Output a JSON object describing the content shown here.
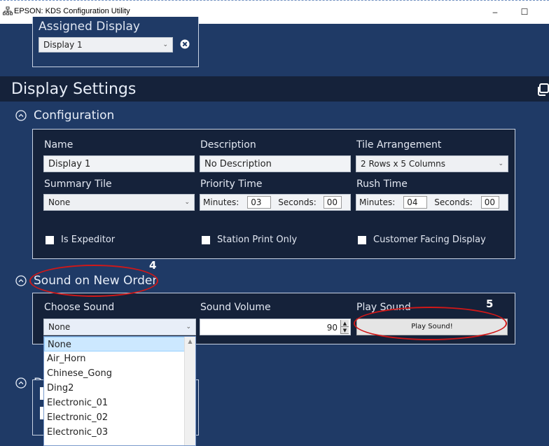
{
  "window": {
    "title": "EPSON: KDS Configuration Utility",
    "min_glyph": "–",
    "max_glyph": "☐"
  },
  "assigned_display": {
    "label": "Assigned Display",
    "value": "Display 1"
  },
  "display_settings": {
    "title": "Display Settings"
  },
  "configuration": {
    "section_title": "Configuration",
    "name_label": "Name",
    "name_value": "Display 1",
    "description_label": "Description",
    "description_value": "No Description",
    "tile_label": "Tile Arrangement",
    "tile_value": "2 Rows x 5 Columns",
    "summary_label": "Summary Tile",
    "summary_value": "None",
    "priority_label": "Priority Time",
    "priority_minutes_label": "Minutes:",
    "priority_minutes": "03",
    "priority_seconds_label": "Seconds:",
    "priority_seconds": "00",
    "rush_label": "Rush Time",
    "rush_minutes_label": "Minutes:",
    "rush_minutes": "04",
    "rush_seconds_label": "Seconds:",
    "rush_seconds": "00",
    "is_expeditor": "Is Expeditor",
    "station_print_only": "Station Print Only",
    "customer_facing": "Customer Facing Display"
  },
  "sound": {
    "section_title": "Sound on New Order",
    "choose_label": "Choose Sound",
    "choose_value": "None",
    "volume_label": "Sound Volume",
    "volume_value": "90",
    "play_label": "Play Sound",
    "play_button": "Play Sound!",
    "options": [
      "None",
      "Air_Horn",
      "Chinese_Gong",
      "Ding2",
      "Electronic_01",
      "Electronic_02",
      "Electronic_03"
    ]
  },
  "third_section": {
    "title_partial": "D"
  },
  "annotations": {
    "num4": "4",
    "num5": "5"
  },
  "colors": {
    "background": "#1f3a66",
    "header_bar": "#15223a",
    "annotation": "#d01818"
  }
}
